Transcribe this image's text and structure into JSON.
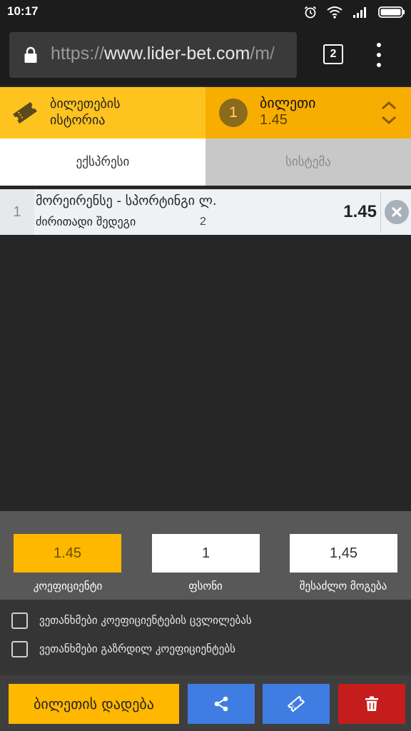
{
  "status_bar": {
    "time": "10:17",
    "icons": [
      "alarm-icon",
      "wifi-icon",
      "signal-icon",
      "battery-icon"
    ]
  },
  "browser": {
    "url_scheme": "https://",
    "url_host": "www.lider-bet.com",
    "url_rest": "/m/",
    "tab_count": "2"
  },
  "header": {
    "history_label": "ბილეთების ისტორია",
    "history_line1": "ბილეთების",
    "history_line2": "ისტორია",
    "ticket_count": "1",
    "ticket_label": "ბილეთი",
    "ticket_odds": "1.45"
  },
  "tabs": [
    {
      "label": "ექსპრესი",
      "active": true
    },
    {
      "label": "სისტემა",
      "active": false
    }
  ],
  "bets": [
    {
      "index": "1",
      "event": "მორეირენსე - სპორტინგი ლ.",
      "market": "ძირითადი შედეგი",
      "pick": "2",
      "odds": "1.45"
    }
  ],
  "summary": {
    "coefficient_value": "1.45",
    "coefficient_label": "კოეფიციენტი",
    "stake_value": "1",
    "stake_label": "ფსონი",
    "win_value": "1,45",
    "win_label": "შესაძლო მოგება"
  },
  "agreements": [
    {
      "label": "ვეთანხმები კოეფიციენტების ცვლილებას",
      "checked": false
    },
    {
      "label": "ვეთანხმები გაზრდილ კოეფიციენტებს",
      "checked": false
    }
  ],
  "actions": {
    "place_label": "ბილეთის დადება"
  },
  "colors": {
    "yellow": "#ffc31f",
    "orange": "#f8ae00",
    "blue": "#3f7de3",
    "red": "#c51c1c",
    "dark": "#262626"
  }
}
